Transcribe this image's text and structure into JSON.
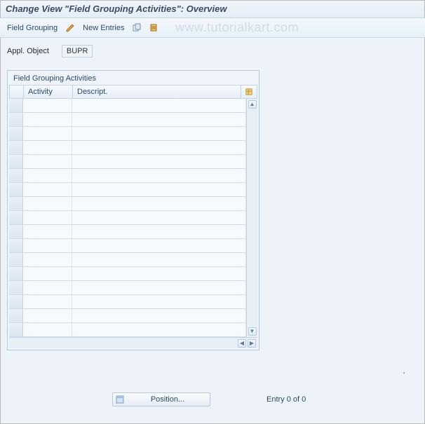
{
  "title": "Change View \"Field Grouping Activities\": Overview",
  "toolbar": {
    "field_grouping_label": "Field Grouping",
    "new_entries_label": "New Entries"
  },
  "watermark": "www.tutorialkart.com",
  "appl_object": {
    "label": "Appl. Object",
    "value": "BUPR"
  },
  "table": {
    "title": "Field Grouping Activities",
    "columns": {
      "activity": "Activity",
      "description": "Descript."
    },
    "row_count": 17
  },
  "footer": {
    "position_label": "Position...",
    "entry_status": "Entry 0 of 0"
  }
}
